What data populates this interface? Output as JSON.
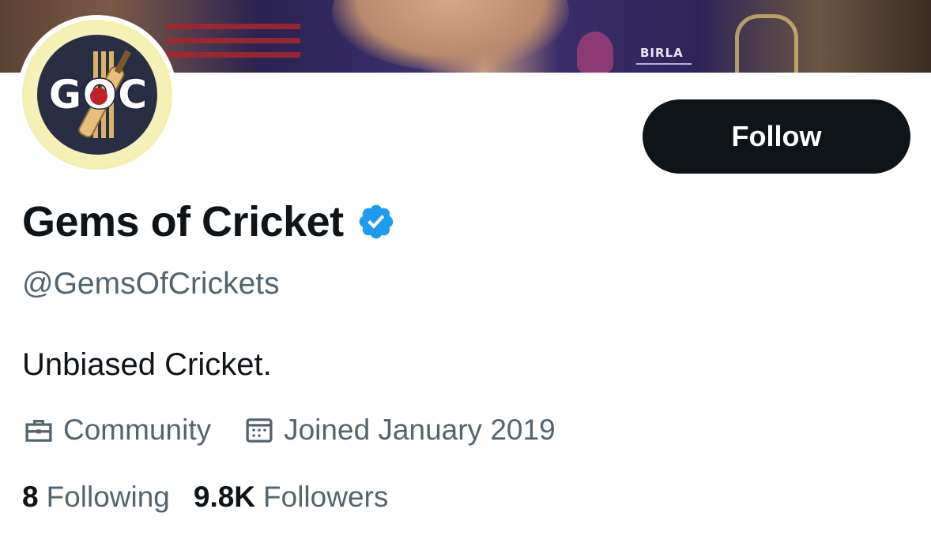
{
  "profile": {
    "avatar_text": "GOC",
    "display_name": "Gems of Cricket",
    "handle": "@GemsOfCrickets",
    "bio": "Unbiased Cricket.",
    "category": "Community",
    "joined": "Joined January 2019",
    "verified_icon": "verified-badge-icon"
  },
  "banner": {
    "logo_text": "BIRLA"
  },
  "actions": {
    "follow_label": "Follow"
  },
  "stats": {
    "following_count": "8",
    "following_label": "Following",
    "followers_count": "9.8K",
    "followers_label": "Followers"
  },
  "colors": {
    "text_primary": "#0f1419",
    "text_secondary": "#536471",
    "verified_blue": "#1d9bf0",
    "button_bg": "#0f1419"
  }
}
